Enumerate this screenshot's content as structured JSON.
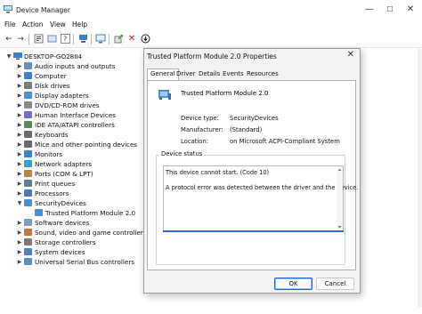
{
  "window": {
    "title": "Device Manager",
    "caption_buttons": [
      "—",
      "☐",
      "✕"
    ]
  },
  "menu": [
    "File",
    "Action",
    "View",
    "Help"
  ],
  "toolbar": {
    "icons": [
      "back-arrow-icon",
      "forward-arrow-icon",
      "properties-icon",
      "show-hidden-icon",
      "help-icon",
      "scan-hardware-icon",
      "monitor-icon",
      "update-driver-icon",
      "uninstall-device-icon",
      "disable-device-icon"
    ]
  },
  "tree": {
    "root": "DESKTOP-GO28II4",
    "categories": [
      "Audio inputs and outputs",
      "Computer",
      "Disk drives",
      "Display adapters",
      "DVD/CD-ROM drives",
      "Human Interface Devices",
      "IDE ATA/ATAPI controllers",
      "Keyboards",
      "Mice and other pointing devices",
      "Monitors",
      "Network adapters",
      "Ports (COM & LPT)",
      "Print queues",
      "Processors",
      "SecurityDevices",
      "Software devices",
      "Sound, video and game controllers",
      "Storage controllers",
      "System devices",
      "Universal Serial Bus controllers"
    ],
    "expanded_child": "Trusted Platform Module 2.0"
  },
  "dialog": {
    "title": "Trusted Platform Module 2.0 Properties",
    "close_glyph": "✕",
    "tabs": [
      "General",
      "Driver",
      "Details",
      "Events",
      "Resources"
    ],
    "active_tab": "General",
    "device_name": "Trusted Platform Module 2.0",
    "properties": [
      {
        "label": "Device type:",
        "value": "SecurityDevices"
      },
      {
        "label": "Manufacturer:",
        "value": "(Standard)"
      },
      {
        "label": "Location:",
        "value": "on Microsoft ACPI-Compliant System"
      }
    ],
    "status_label": "Device status",
    "status_lines": [
      "This device cannot start. (Code 10)",
      "A protocol error was detected between the driver and the device."
    ],
    "ok_label": "OK",
    "cancel_label": "Cancel"
  },
  "colors": {
    "accent": "#1f63c8",
    "folder": "#e8c15a",
    "device": "#4a8fd6"
  }
}
